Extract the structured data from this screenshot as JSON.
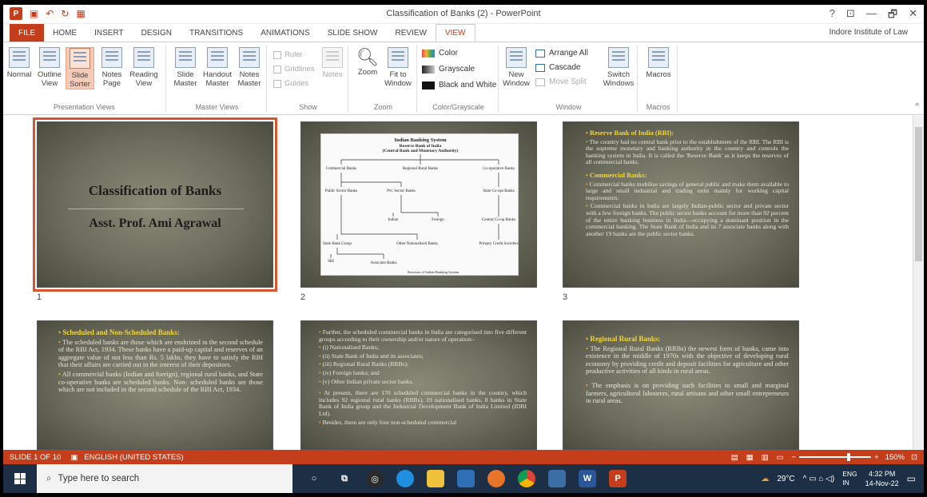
{
  "window": {
    "title": "Classification of Banks (2) - PowerPoint",
    "account": "Indore Institute of Law",
    "controls": [
      "?",
      "⊡",
      "—",
      "🗗",
      "✕"
    ]
  },
  "tabs": [
    "FILE",
    "HOME",
    "INSERT",
    "DESIGN",
    "TRANSITIONS",
    "ANIMATIONS",
    "SLIDE SHOW",
    "REVIEW",
    "VIEW"
  ],
  "active_tab": "VIEW",
  "ribbon": {
    "presentation_views": {
      "label": "Presentation Views",
      "buttons": [
        "Normal",
        "Outline View",
        "Slide Sorter",
        "Notes Page",
        "Reading View"
      ]
    },
    "master_views": {
      "label": "Master Views",
      "buttons": [
        "Slide Master",
        "Handout Master",
        "Notes Master"
      ]
    },
    "show": {
      "label": "Show",
      "items": [
        "Ruler",
        "Gridlines",
        "Guides"
      ],
      "notes": "Notes"
    },
    "zoom": {
      "label": "Zoom",
      "buttons": [
        "Zoom",
        "Fit to Window"
      ]
    },
    "color": {
      "label": "Color/Grayscale",
      "items": [
        "Color",
        "Grayscale",
        "Black and White"
      ]
    },
    "window": {
      "label": "Window",
      "new_window": "New Window",
      "items": [
        "Arrange All",
        "Cascade",
        "Move Split"
      ],
      "switch": "Switch Windows"
    },
    "macros": {
      "label": "Macros",
      "button": "Macros"
    }
  },
  "slides": [
    {
      "num": "1",
      "title": "Classification of Banks",
      "subtitle": "Asst. Prof. Ami Agrawal"
    },
    {
      "num": "2",
      "chart_title": "Indian Banking System",
      "chart_sub1": "Reserve Bank of India",
      "chart_sub2": "(Central Bank and Monetary Authority)",
      "nodes": [
        "Commercial Banks",
        "Regional Rural Banks",
        "Co-operative Banks",
        "Public Sector Banks",
        "Pvt. Sector Banks",
        "State Co-ops Banks",
        "Indian",
        "Foreign",
        "Central Co-op Banks",
        "State Bank Group",
        "Other Nationalised Banks",
        "Primary Credit Societies",
        "SBI",
        "Associate Banks"
      ],
      "footer": "Structure of Indian Banking System"
    },
    {
      "num": "3",
      "h1": "Reserve Bank of India (RBI):",
      "p1": "The country had no central bank prior to the establishment of the RBI. The RBI is the supreme monetary and banking authority in the country and controls the banking system in India. It is called the 'Reserve Bank' as it keeps the reserves of all commercial banks.",
      "h2": "Commercial Banks:",
      "p2": "Commercial banks mobilise savings of general public and make them available to large and small industrial and trading units mainly for working capital requirements.",
      "p3": "Commercial banks in India are largely Indian-public sector and private sector with a few foreign banks. The public sector banks account for more than 92 percent of the entire banking business in India—occupying a dominant position in the commercial banking. The State Bank of India and its 7 associate banks along with another 19 banks are the public sector banks."
    },
    {
      "num": "4",
      "h1": "Scheduled and Non-Scheduled Banks:",
      "p1": "The scheduled banks are those which are enshrined in the second schedule of the RBI Act, 1934. These banks have a paid-up capital and reserves of an aggregate value of not less than Rs. 5 lakhs, they have to satisfy the RBI that their affairs are carried out in the interest of their depositors.",
      "p2": "All commercial banks (Indian and foreign), regional rural banks, and State co-operative banks are scheduled banks. Non- scheduled banks are those which are not included in the second schedule of the RBI Act, 1934."
    },
    {
      "num": "5",
      "p1": "Further, the scheduled commercial banks in India are categorised into five different groups according to their ownership and/or nature of operation:-",
      "list": [
        "(i) Nationalised Banks;",
        "(ii) State Bank of India and its associates;",
        "(iii) Regional Rural Banks (RRBs);",
        "(iv) Foreign banks; and",
        "(v) Other Indian private sector banks."
      ],
      "p2": "At present, there are 170 scheduled commercial banks in the country, which includes 92 regional rural banks (RRBs), 19 nationalised banks, 8 banks in State Bank of India group and the Industrial Development Bank of India Limited (IDBI Ltd).",
      "p3": "Besides, there are only four non-scheduled commercial"
    },
    {
      "num": "6",
      "h1": "Regional Rural Banks:",
      "p1": "The Regional Rural Banks (RRBs) the newest form of banks, came into existence in the middle of 1970s with the objective of developing rural economy by providing credit and deposit facilities for agriculture and other productive activities of all kinds in rural areas.",
      "p2": "The emphasis is on providing such facilities to small and marginal farmers, agricultural labourers, rural artisans and other small entrepreneurs in rural areas."
    }
  ],
  "status": {
    "slide": "SLIDE 1 OF 10",
    "language": "ENGLISH (UNITED STATES)",
    "zoom": "150%"
  },
  "taskbar": {
    "search_placeholder": "Type here to search",
    "weather": "29°C",
    "lang1": "ENG",
    "lang2": "IN",
    "time": "4:32 PM",
    "date": "14-Nov-22"
  }
}
